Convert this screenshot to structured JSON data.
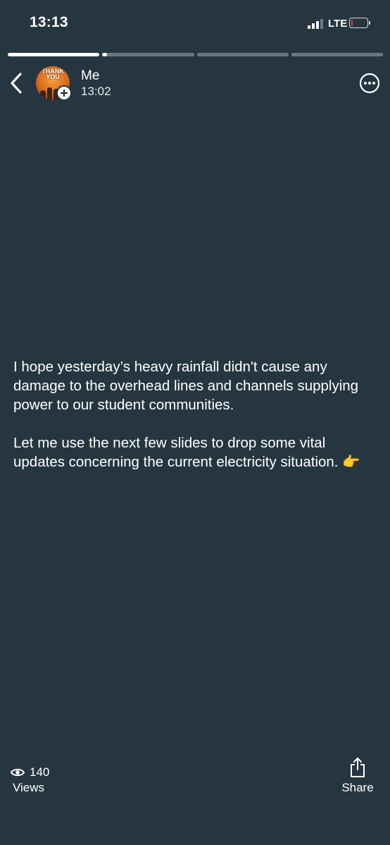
{
  "status_bar": {
    "time": "13:13",
    "network": "LTE",
    "signal_bars_active": 3,
    "signal_bars_total": 4,
    "battery_level_fraction": 0.12,
    "battery_color": "#ef3b32"
  },
  "story": {
    "segments_total": 4,
    "current_segment": 2,
    "segment_progress": [
      1.0,
      0.05,
      0.0,
      0.0
    ],
    "author": "Me",
    "posted_time": "13:02",
    "avatar_caption": "THANK YOU",
    "paragraphs": [
      "I hope yesterday’s heavy rainfall didn't cause any damage to the overhead lines and channels supplying power to our student communities.",
      "Let me use the next few slides to drop some vital updates concerning the current electricity situation. 👉"
    ],
    "background_color": "#263640"
  },
  "footer": {
    "views_count": "140",
    "views_label": "Views",
    "share_label": "Share"
  },
  "icons": {
    "back": "chevron-left-icon",
    "more": "ellipsis-circle-icon",
    "views": "eye-icon",
    "share": "share-icon",
    "add": "plus-icon"
  }
}
